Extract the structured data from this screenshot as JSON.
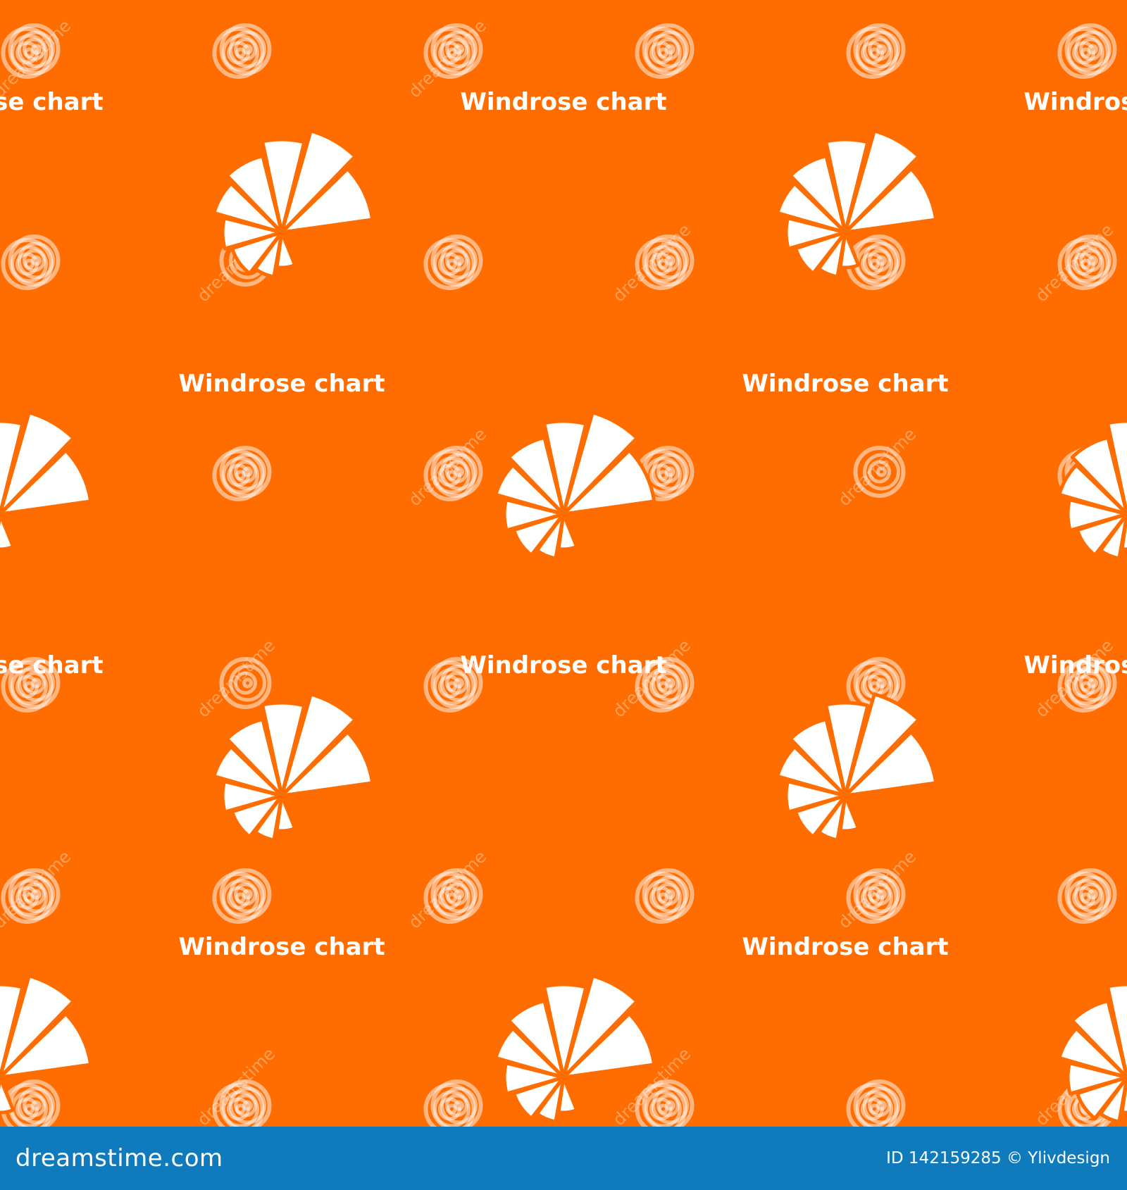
{
  "tile": {
    "label": "Windrose chart",
    "icon": "windrose-chart-icon",
    "watermark_text": "dreamstime",
    "watermark_icon": "dreamstime-spiral-icon"
  },
  "colors": {
    "background": "#ff6c00",
    "foreground": "#ffffff",
    "footer": "#0f7bbc"
  },
  "footer": {
    "brand": "dreamstime.com",
    "credit": "ID 142159285 © Ylivdesign"
  }
}
